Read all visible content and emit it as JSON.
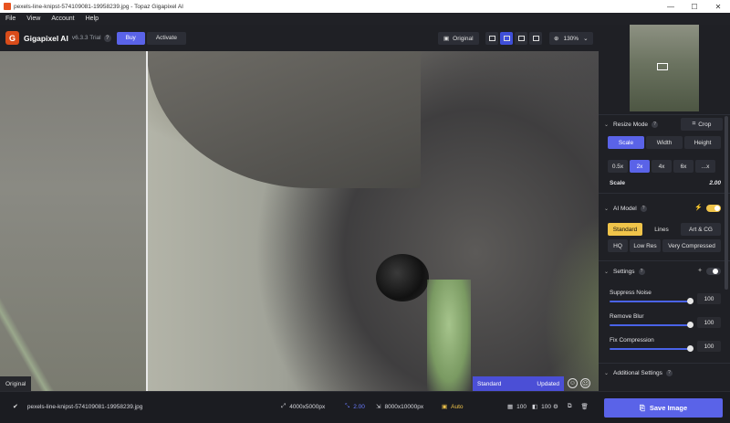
{
  "window": {
    "title": "pexels-line-knipst-574109081-19958239.jpg - Topaz Gigapixel AI",
    "controls": [
      "—",
      "☐",
      "✕"
    ]
  },
  "menu": [
    "File",
    "View",
    "Account",
    "Help"
  ],
  "toolbar": {
    "brand": "Gigapixel AI",
    "version": "v6.3.3 Trial",
    "help": "?",
    "buy": "Buy",
    "activate": "Activate",
    "original": "Original",
    "zoom": "130%"
  },
  "viewer": {
    "original_label": "Original",
    "status_model": "Standard",
    "status_state": "Updated"
  },
  "panel": {
    "resize_mode": {
      "title": "Resize Mode",
      "crop": "Crop",
      "tabs": [
        "Scale",
        "Width",
        "Height"
      ],
      "scales": [
        "0.5x",
        "2x",
        "4x",
        "6x",
        "...x"
      ],
      "scale_label": "Scale",
      "scale_value": "2.00"
    },
    "ai_model": {
      "title": "AI Model",
      "enabled": true,
      "row1": [
        "Standard",
        "Lines",
        "Art & CG"
      ],
      "row2": [
        "HQ",
        "Low Res",
        "Very Compressed"
      ]
    },
    "settings": {
      "title": "Settings",
      "items": [
        {
          "label": "Suppress Noise",
          "value": "100",
          "level": 1.0
        },
        {
          "label": "Remove Blur",
          "value": "100",
          "level": 1.0
        },
        {
          "label": "Fix Compression",
          "value": "100",
          "level": 1.0
        }
      ]
    },
    "additional": {
      "title": "Additional Settings"
    }
  },
  "bottom": {
    "filename": "pexels-line-knipst-574109081-19958239.jpg",
    "input_size": "4000x5000px",
    "scale": "2.00",
    "output_size": "8000x10000px",
    "auto": "Auto",
    "quality": "100",
    "compression": "100",
    "save": "Save Image"
  }
}
